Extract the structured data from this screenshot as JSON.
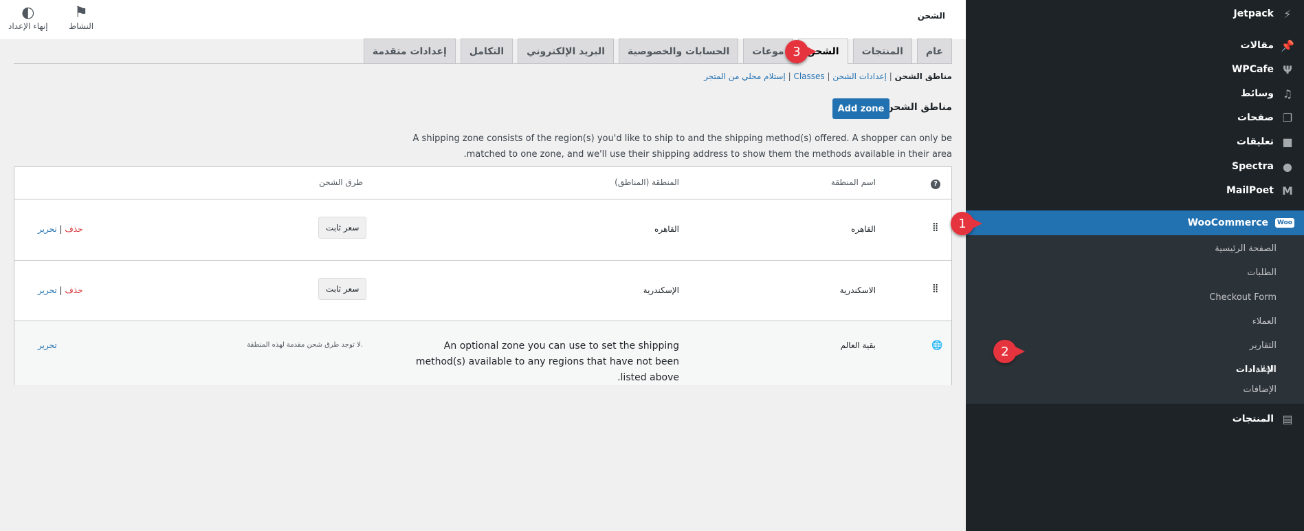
{
  "sidebar": {
    "items": [
      {
        "label": "Jetpack",
        "icon": "jetpack-icon"
      },
      {
        "label": "مقالات",
        "icon": "pin-icon"
      },
      {
        "label": "WPCafe",
        "icon": "cafe-icon"
      },
      {
        "label": "وسائط",
        "icon": "media-icon"
      },
      {
        "label": "صفحات",
        "icon": "pages-icon"
      },
      {
        "label": "تعليقات",
        "icon": "comments-icon"
      },
      {
        "label": "Spectra",
        "icon": "spectra-icon"
      },
      {
        "label": "MailPoet",
        "icon": "mailpoet-icon"
      },
      {
        "label": "WooCommerce",
        "icon": "woo-icon",
        "badge": "Woo"
      },
      {
        "label": "المنتجات",
        "icon": "products-icon"
      }
    ],
    "submenu": [
      "الصفحة الرئيسية",
      "الطلبات",
      "Checkout Form",
      "العملاء",
      "التقارير",
      "الإعدادات",
      "الحالة",
      "الإضافات"
    ]
  },
  "topbar": {
    "title": "الشحن",
    "activity": "النشاط",
    "finish_setup": "إنهاء الإعداد"
  },
  "tabs": [
    "عام",
    "المنتجات",
    "الشحن",
    "موعات",
    "الحسابات والخصوصية",
    "البريد الإلكتروني",
    "التكامل",
    "إعدادات متقدمة"
  ],
  "subnav": {
    "current": "مناطق الشحن",
    "links": [
      "إعدادات الشحن",
      "Classes",
      "إستلام محلي من المتجر"
    ],
    "sep": "|"
  },
  "section": {
    "title": "مناطق الشحن",
    "add_zone": "Add zone",
    "description": "A shipping zone consists of the region(s) you'd like to ship to and the shipping method(s) offered. A shopper can only be matched to one zone, and we'll use their shipping address to show them the methods available in their area."
  },
  "table": {
    "headers": {
      "name": "اسم المنطقة",
      "regions": "المنطقة (المناطق)",
      "methods": "طرق الشحن"
    },
    "rows": [
      {
        "name": "القاهره",
        "region": "القاهره",
        "method": "سعر ثابت",
        "edit": "تحرير",
        "delete": "حذف"
      },
      {
        "name": "الاسكندرية",
        "region": "الإسكندرية",
        "method": "سعر ثابت",
        "edit": "تحرير",
        "delete": "حذف"
      }
    ],
    "rest": {
      "name": "بقية العالم",
      "region": "An optional zone you can use to set the shipping method(s) available to any regions that have not been listed above.",
      "method": "لا توجد طرق شحن مقدمة لهذه المنطقة.",
      "edit": "تحرير"
    }
  },
  "annotations": [
    "1",
    "2",
    "3"
  ]
}
